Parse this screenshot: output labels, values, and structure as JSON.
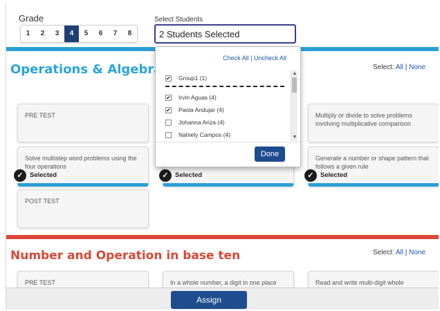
{
  "grade": {
    "label": "Grade",
    "options": [
      "1",
      "2",
      "3",
      "4",
      "5",
      "6",
      "7",
      "8"
    ],
    "active": "4"
  },
  "students": {
    "label": "Select Students",
    "value": "2 Students Selected"
  },
  "section1": {
    "title": "Operations & Algebraic Think",
    "select_label": "Select:",
    "all": "All",
    "none": "None",
    "cards": {
      "pre_test": "PRE TEST",
      "solve": "Solve multistep word problems using the four operations",
      "multiply": "Multiply or divide to solve problems involving multiplicative comparison",
      "generate": "Generate a number or shape pattern that follows a given rule",
      "post_test": "POST TEST",
      "selected": "Selected"
    }
  },
  "section2": {
    "title": "Number and Operation in base ten",
    "select_label": "Select:",
    "all": "All",
    "none": "None",
    "cards": {
      "pre_test": "PRE TEST",
      "whole_number": "In a whole number, a digit in one place",
      "read_write": "Read and write multi-digit whole"
    }
  },
  "dropdown": {
    "check_all": "Check All",
    "separator": "|",
    "uncheck_all": "Uncheck All",
    "group": {
      "label": "Group1 (1)",
      "checked": true
    },
    "students": [
      {
        "name": "Irvin Aguas (4)",
        "checked": true
      },
      {
        "name": "Paola Andujar (4)",
        "checked": true
      },
      {
        "name": "Johanna Ariza (4)",
        "checked": false
      },
      {
        "name": "Nahiely Campos (4)",
        "checked": false
      }
    ],
    "done": "Done"
  },
  "footer": {
    "assign": "Assign"
  },
  "colors": {
    "blue_accent": "#2a9fd6",
    "red_accent": "#d9473b",
    "button_navy": "#1e4d8f",
    "title_blue": "#2aa6d9",
    "title_red": "#d54937"
  },
  "icons": {
    "selected": "checkmark-circle-icon",
    "checkbox": "checkbox-icon",
    "scroll_up": "chevron-up-icon",
    "scroll_down": "chevron-down-icon"
  }
}
